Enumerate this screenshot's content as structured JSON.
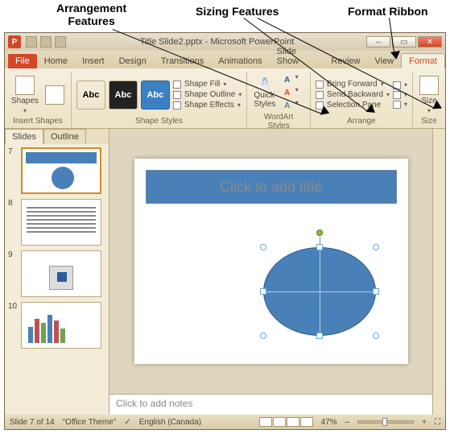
{
  "callouts": {
    "arrangement": "Arrangement\nFeatures",
    "sizing": "Sizing Features",
    "format_ribbon": "Format Ribbon"
  },
  "window": {
    "title": "Title Slide2.pptx - Microsoft PowerPoint",
    "app_letter": "P",
    "min": "Minimize",
    "max": "Restore",
    "close": "Close"
  },
  "tabs": {
    "file": "File",
    "home": "Home",
    "insert": "Insert",
    "design": "Design",
    "transitions": "Transitions",
    "animations": "Animations",
    "slideshow": "Slide Show",
    "review": "Review",
    "view": "View",
    "format": "Format"
  },
  "ribbon": {
    "insert_shapes": {
      "shapes": "Shapes",
      "group": "Insert Shapes"
    },
    "shape_styles": {
      "group": "Shape Styles",
      "abc": "Abc",
      "fill": "Shape Fill",
      "outline": "Shape Outline",
      "effects": "Shape Effects"
    },
    "wordart": {
      "quick": "Quick\nStyles",
      "group": "WordArt Styles"
    },
    "arrange": {
      "bring": "Bring Forward",
      "send": "Send Backward",
      "pane": "Selection Pane",
      "group": "Arrange"
    },
    "size": {
      "size": "Size",
      "group": "Size"
    }
  },
  "sidepanel": {
    "slides": "Slides",
    "outline": "Outline"
  },
  "thumbs": {
    "n7": "7",
    "n8": "8",
    "n9": "9",
    "n10": "10"
  },
  "slide": {
    "title_ph": "Click to add title"
  },
  "notes": {
    "placeholder": "Click to add notes"
  },
  "status": {
    "counter": "Slide 7 of 14",
    "theme": "\"Office Theme\"",
    "lang": "English (Canada)",
    "zoom": "47%"
  }
}
